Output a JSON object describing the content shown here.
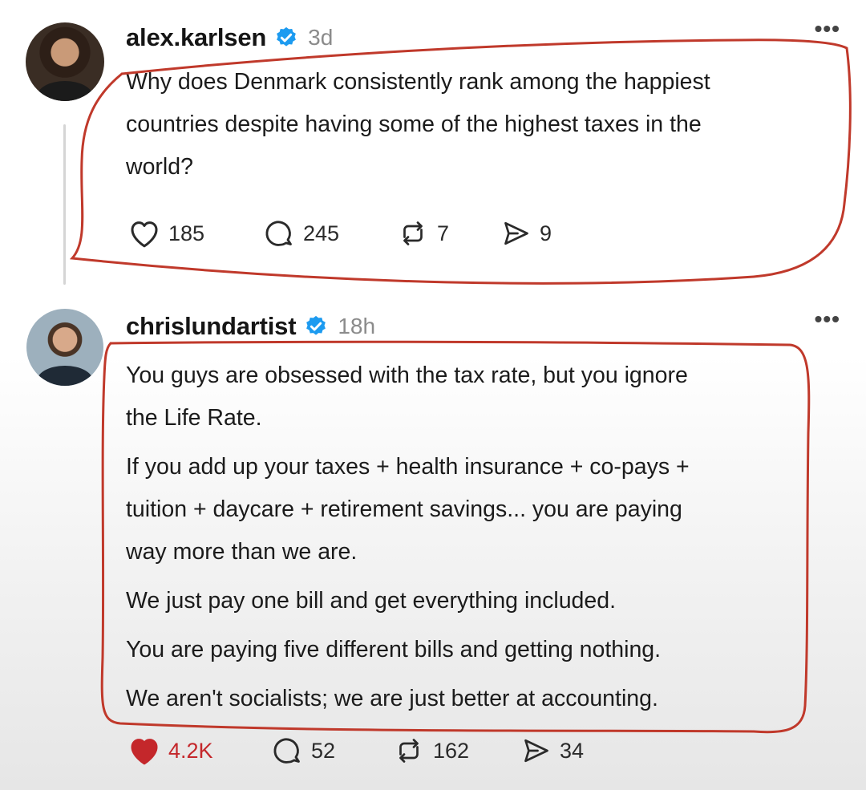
{
  "posts": [
    {
      "username": "alex.karlsen",
      "time": "3d",
      "more": "•••",
      "text": [
        "Why does Denmark consistently rank among the happiest",
        "countries despite having some of the highest taxes in the",
        "world?"
      ],
      "likes": "185",
      "replies": "245",
      "reposts": "7",
      "shares": "9",
      "liked": false
    },
    {
      "username": "chrislundartist",
      "time": "18h",
      "more": "•••",
      "paragraphs": [
        [
          "You guys are obsessed with the tax rate, but you ignore",
          "the Life Rate."
        ],
        [
          "If you add up your taxes + health insurance + co-pays +",
          "tuition + daycare + retirement savings... you are paying",
          "way more than we are."
        ],
        [
          "We just pay one bill and get everything included."
        ],
        [
          "You are paying five different bills and getting nothing."
        ],
        [
          "We aren't socialists; we are just better at accounting."
        ]
      ],
      "likes": "4.2K",
      "replies": "52",
      "reposts": "162",
      "shares": "34",
      "liked": true
    }
  ],
  "colors": {
    "verified": "#1d9bf0",
    "liked": "#c4272b",
    "annotation": "#c0392b"
  },
  "icons": [
    "heart-icon",
    "reply-icon",
    "repost-icon",
    "share-icon",
    "verified-icon",
    "more-icon"
  ]
}
